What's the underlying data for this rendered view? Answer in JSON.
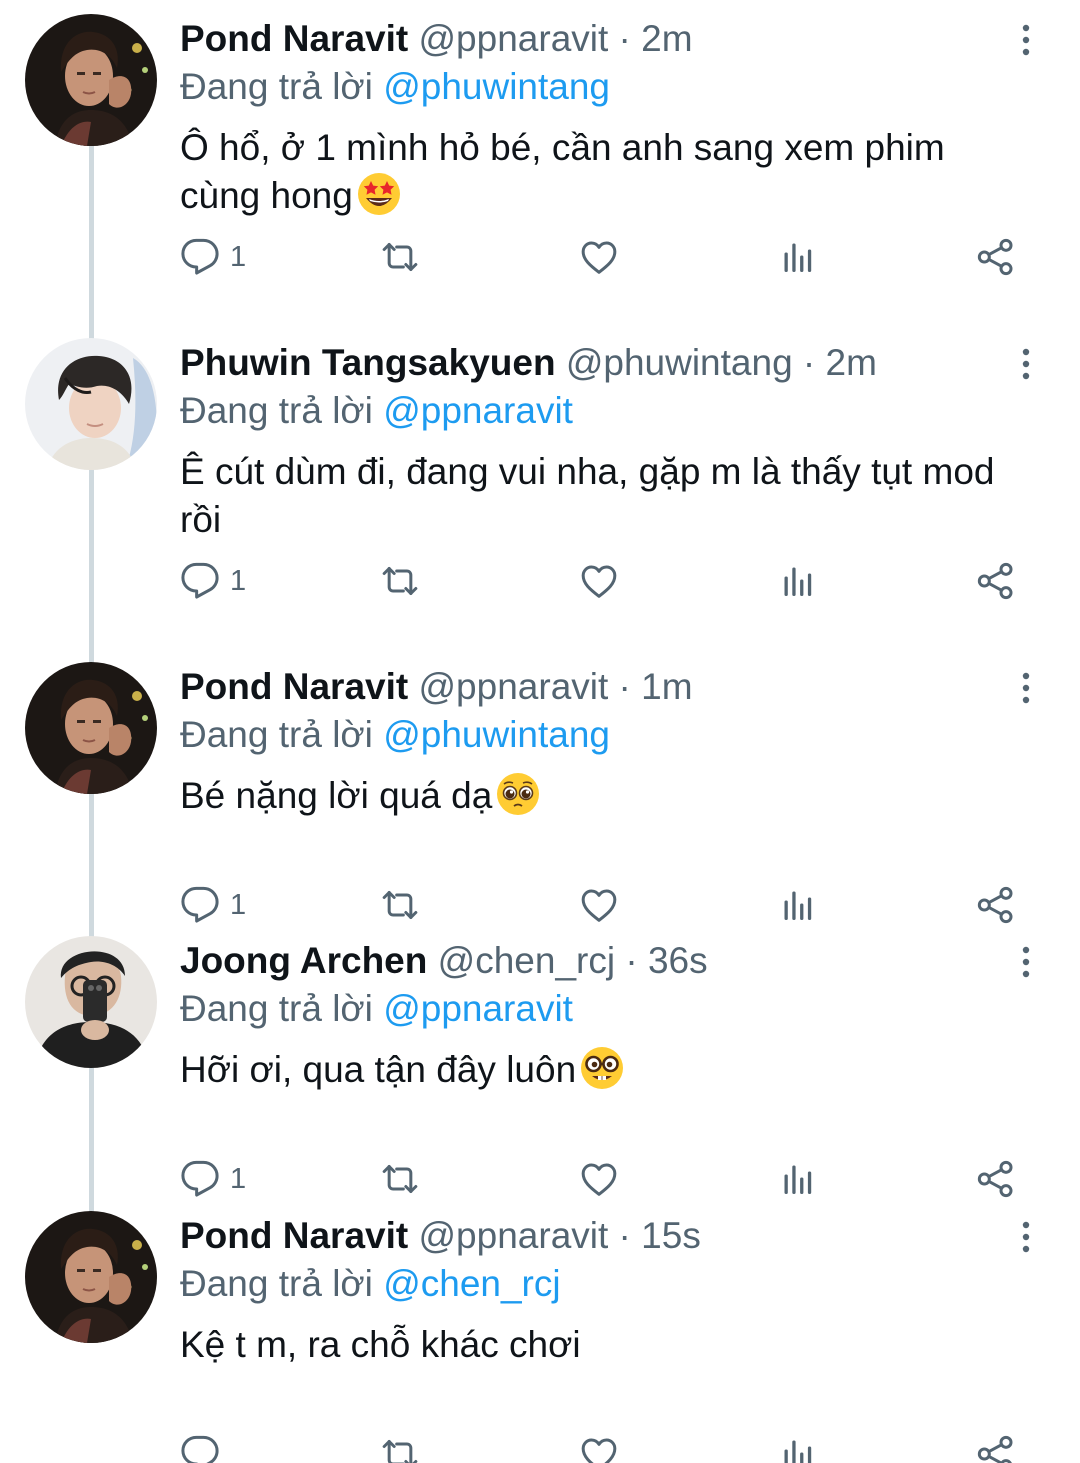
{
  "reply_prefix": "Đang trả lời",
  "colors": {
    "mention": "#1d9bf0",
    "secondary_text": "#536471",
    "primary_text": "#0f1419",
    "icon": "#536471",
    "thread_line": "#cfd9de"
  },
  "tweets": [
    {
      "name": "Pond Naravit",
      "handle": "@ppnaravit",
      "time": "2m",
      "reply_to": "@phuwintang",
      "text": "Ô hổ, ở 1 mình hỏ bé, cần anh sang xem phim cùng hong",
      "emoji": "star-struck-emoji",
      "reply_count": "1",
      "avatar": "pond-avatar"
    },
    {
      "name": "Phuwin Tangsakyuen",
      "handle": "@phuwintang",
      "time": "2m",
      "reply_to": "@ppnaravit",
      "text": "Ê cút dùm đi, đang vui nha, gặp m là thấy tụt mod rồi",
      "emoji": "",
      "reply_count": "1",
      "avatar": "phuwin-avatar"
    },
    {
      "name": "Pond Naravit",
      "handle": "@ppnaravit",
      "time": "1m",
      "reply_to": "@phuwintang",
      "text": "Bé nặng lời quá dạ",
      "emoji": "pleading-face-emoji",
      "reply_count": "1",
      "avatar": "pond-avatar"
    },
    {
      "name": "Joong Archen",
      "handle": "@chen_rcj",
      "time": "36s",
      "reply_to": "@ppnaravit",
      "text": "Hỡi ơi, qua tận đây luôn",
      "emoji": "nerd-face-emoji",
      "reply_count": "1",
      "avatar": "joong-avatar"
    },
    {
      "name": "Pond Naravit",
      "handle": "@ppnaravit",
      "time": "15s",
      "reply_to": "@chen_rcj",
      "text": "Kệ t m, ra chỗ khác chơi",
      "emoji": "",
      "reply_count": "",
      "avatar": "pond-avatar"
    }
  ]
}
